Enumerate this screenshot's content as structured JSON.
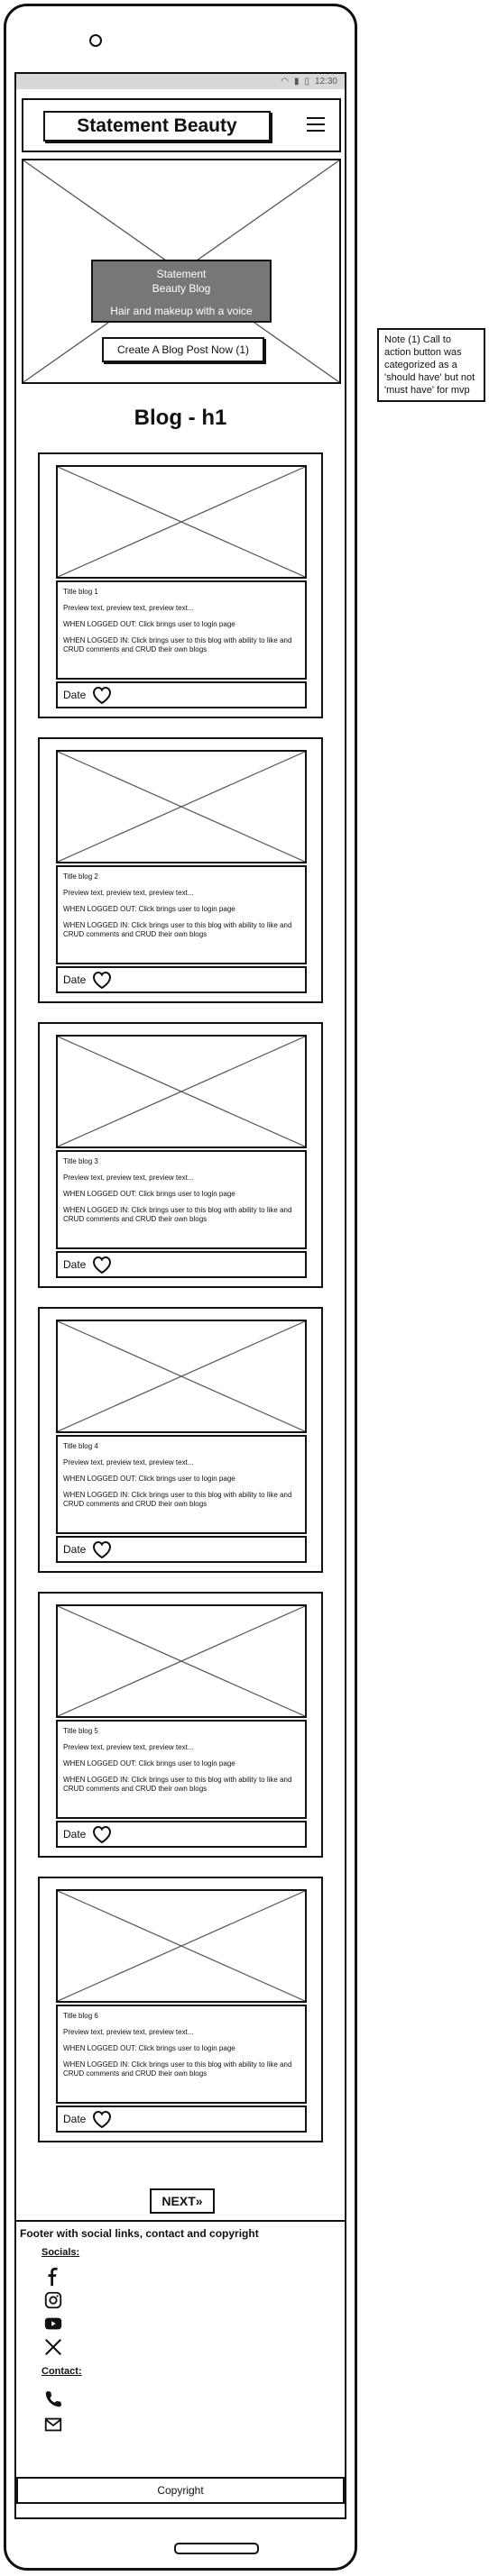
{
  "status_bar": {
    "time": "12:30"
  },
  "header": {
    "brand": "Statement Beauty"
  },
  "hero": {
    "title_line1": "Statement",
    "title_line2": "Beauty Blog",
    "tagline": "Hair and makeup with a voice",
    "cta": "Create A Blog Post Now (1)"
  },
  "page_title": "Blog - h1",
  "posts": [
    {
      "title": "Title blog 1",
      "preview": "Preview text, preview text, preview text...",
      "logged_out": "WHEN LOGGED OUT: Click brings user to login page",
      "logged_in": "WHEN LOGGED IN: Click brings user to this blog with ability to like and CRUD comments and CRUD their own blogs",
      "date": "Date"
    },
    {
      "title": "Title blog 2",
      "preview": "Preview text, preview text, preview text...",
      "logged_out": "WHEN LOGGED OUT: Click brings user to login page",
      "logged_in": "WHEN LOGGED IN: Click brings user to this blog with ability to like and CRUD comments and CRUD their own blogs",
      "date": "Date"
    },
    {
      "title": "Title blog 3",
      "preview": "Preview text, preview text, preview text...",
      "logged_out": "WHEN LOGGED OUT: Click brings user to login page",
      "logged_in": "WHEN LOGGED IN: Click brings user to this blog with ability to like and CRUD comments and CRUD their own blogs",
      "date": "Date"
    },
    {
      "title": "Title blog 4",
      "preview": "Preview text, preview text, preview text...",
      "logged_out": "WHEN LOGGED OUT: Click brings user to login page",
      "logged_in": "WHEN LOGGED IN: Click brings user to this blog with ability to like and CRUD comments and CRUD their own blogs",
      "date": "Date"
    },
    {
      "title": "Title blog 5",
      "preview": "Preview text, preview text, preview text...",
      "logged_out": "WHEN LOGGED OUT: Click brings user to login page",
      "logged_in": "WHEN LOGGED IN: Click brings user to this blog with ability to like and CRUD comments and CRUD their own blogs",
      "date": "Date"
    },
    {
      "title": "Title blog 6",
      "preview": "Preview text, preview text, preview text...",
      "logged_out": "WHEN LOGGED OUT: Click brings user to login page",
      "logged_in": "WHEN LOGGED IN: Click brings user to this blog with ability to like and CRUD comments and CRUD their own blogs",
      "date": "Date"
    }
  ],
  "pagination": {
    "next": "NEXT"
  },
  "footer": {
    "title": "Footer with social links, contact and copyright",
    "socials_label": "Socials:",
    "social_icons": [
      "facebook-icon",
      "instagram-icon",
      "youtube-icon",
      "x-icon"
    ],
    "contact_label": "Contact:",
    "contact_icons": [
      "phone-icon",
      "mail-icon"
    ],
    "copyright": "Copyright"
  },
  "note": "Note (1) Call to action button was categorized as a 'should have' but not 'must have' for mvp"
}
